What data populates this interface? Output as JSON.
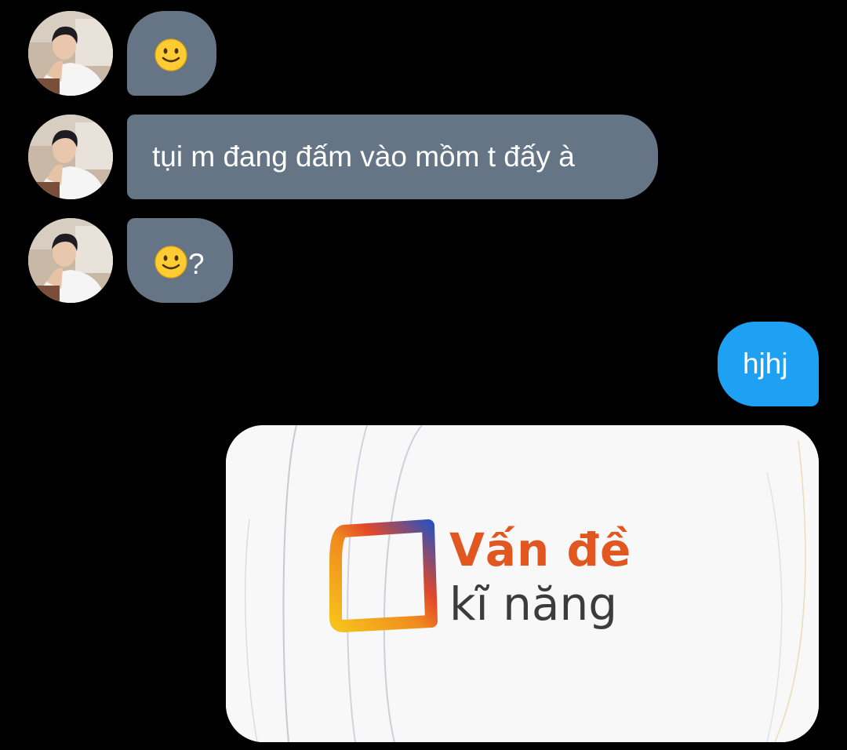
{
  "conversation": {
    "messages": [
      {
        "direction": "incoming",
        "text": "",
        "emoji": "slightly-smiling-face"
      },
      {
        "direction": "incoming",
        "text": "tụi m đang đấm vào mồm t đấy à"
      },
      {
        "direction": "incoming",
        "text": "?",
        "emoji": "slightly-smiling-face"
      },
      {
        "direction": "outgoing",
        "text": "hjhj"
      }
    ],
    "image_message": {
      "title": "Vấn đề",
      "subtitle": "kĩ năng"
    }
  },
  "colors": {
    "background": "#000000",
    "incoming_bubble": "#657585",
    "outgoing_bubble": "#1ea1f2",
    "image_title": "#e2571f",
    "image_subtitle": "#3c3c3c"
  }
}
